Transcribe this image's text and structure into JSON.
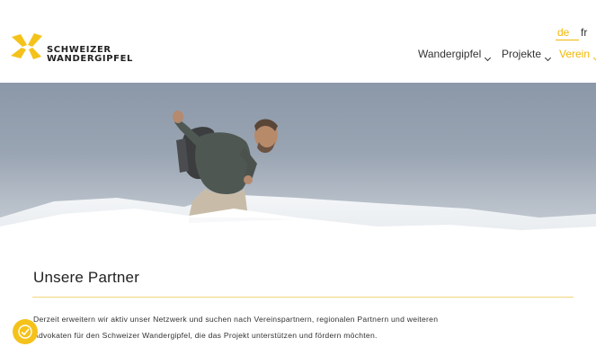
{
  "brand": {
    "line1": "SCHWEIZER",
    "line2": "WANDERGIPFEL",
    "accent_color": "#f2b705"
  },
  "languages": [
    {
      "code": "de",
      "active": true
    },
    {
      "code": "fr",
      "active": false
    }
  ],
  "nav": [
    {
      "label": "Wandergipfel",
      "active": false,
      "icon": "chevron-down-icon"
    },
    {
      "label": "Projekte",
      "active": false,
      "icon": "chevron-down-icon"
    },
    {
      "label": "Verein",
      "active": true,
      "icon": "chevron-down-icon"
    }
  ],
  "content": {
    "title": "Unsere Partner",
    "paragraph_line1": "Derzeit erweitern wir aktiv unser Netzwerk und suchen nach Vereinspartnern, regionalen Partnern und weiteren",
    "paragraph_line2": "Advokaten für den Schweizer Wandergipfel, die das Projekt unterstützen und fördern möchten."
  },
  "cookie_button": {
    "icon": "cookie-settings-icon",
    "color": "#f4c21a"
  }
}
